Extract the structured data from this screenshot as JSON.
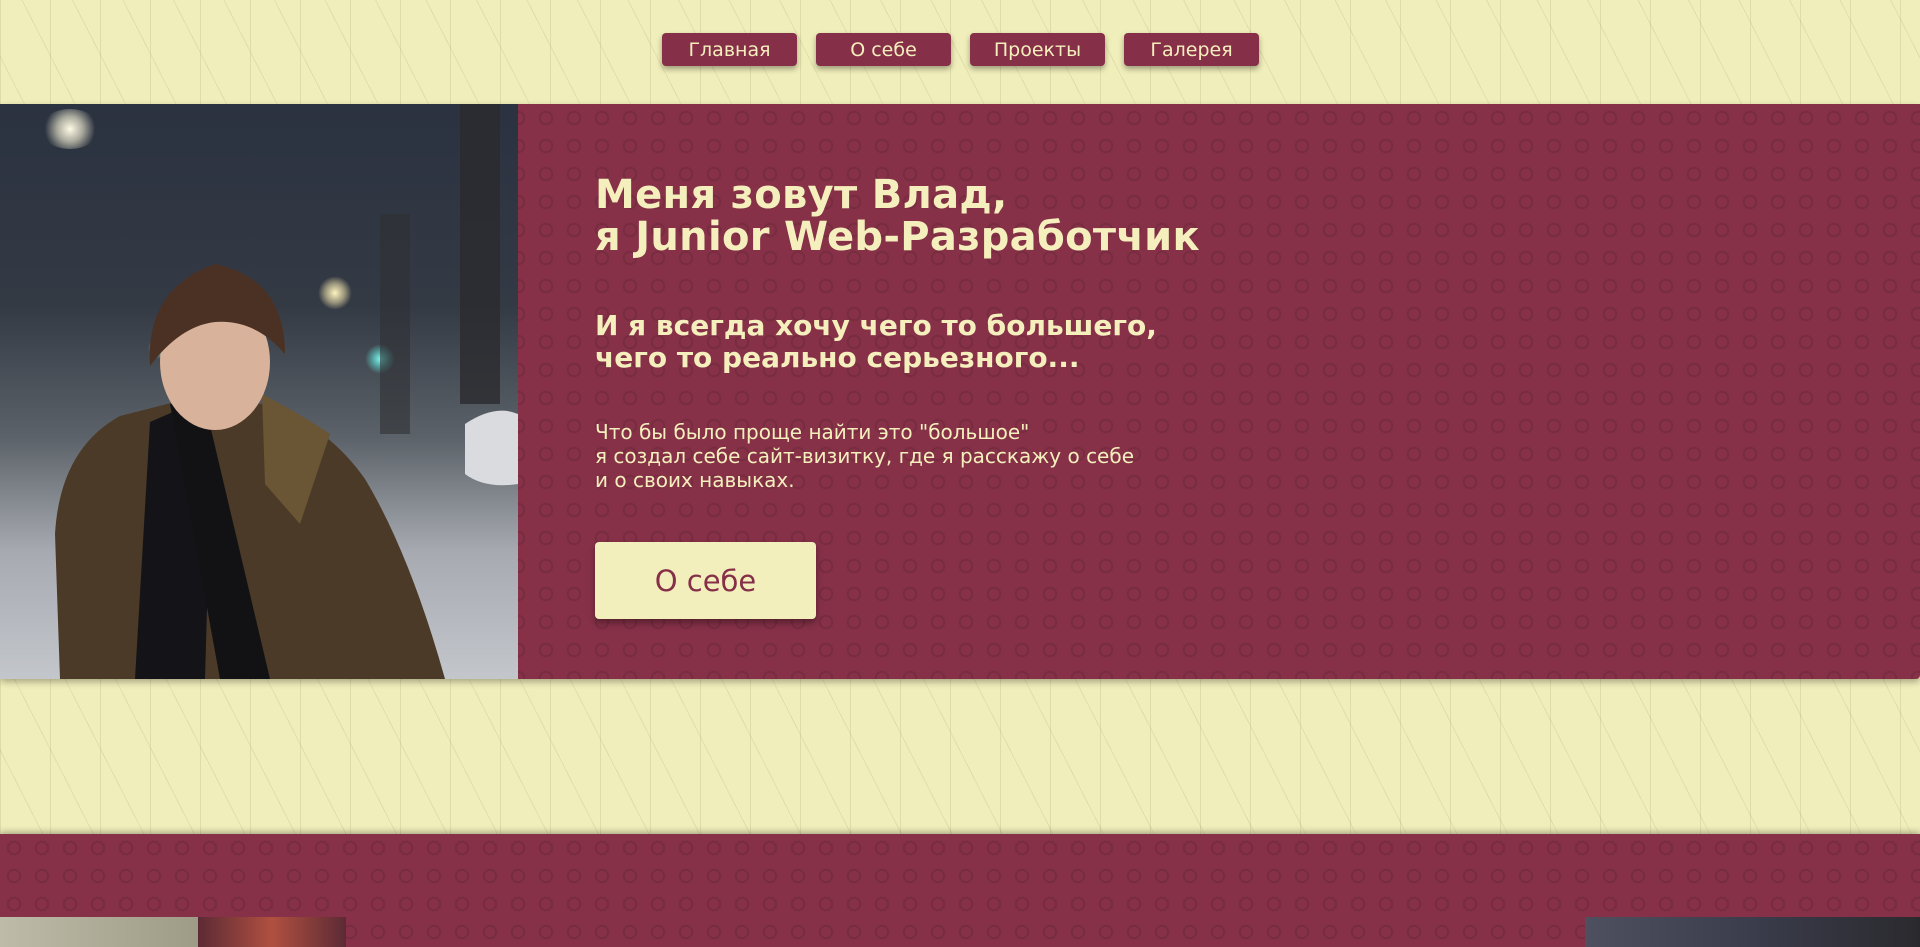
{
  "nav": {
    "items": [
      {
        "label": "Главная",
        "name": "nav-home-button"
      },
      {
        "label": "О себе",
        "name": "nav-about-button"
      },
      {
        "label": "Проекты",
        "name": "nav-projects-button"
      },
      {
        "label": "Галерея",
        "name": "nav-gallery-button"
      }
    ]
  },
  "hero": {
    "title": "Меня зовут Влад,\nя Junior Web-Разработчик",
    "subtitle": "И я всегда хочу чего то большего,\nчего то реально серьезного...",
    "description": "Что бы было проще найти это \"большое\"\nя создал себе сайт-визитку, где я расскажу о себе\nи о своих навыках.",
    "button_label": "О себе"
  },
  "colors": {
    "background": "#f0eeba",
    "accent": "#863148",
    "text_light": "#f5efbd"
  }
}
